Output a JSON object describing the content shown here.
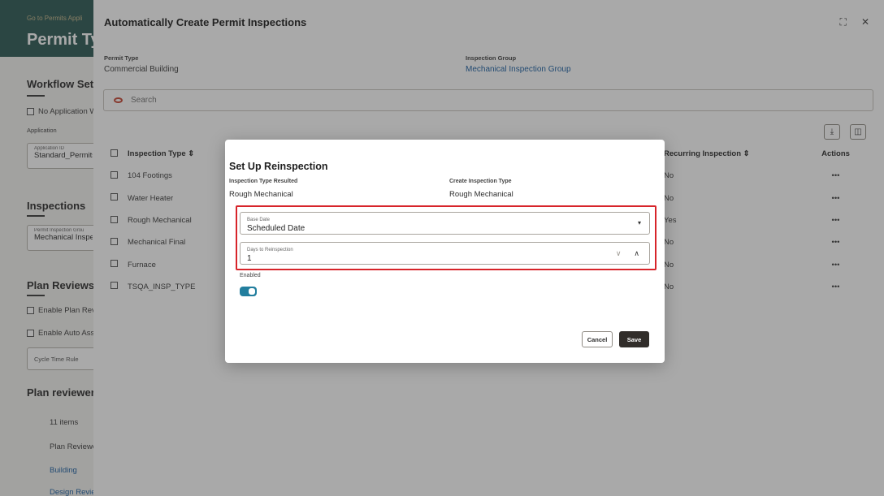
{
  "background": {
    "back_link": "Go to Permits Appli",
    "page_title": "Permit Typ",
    "workflow_heading": "Workflow Setu",
    "no_app_checkbox": "No Application W",
    "application_label": "Application",
    "app_id_label": "Application ID",
    "app_id_value": "Standard_Permits",
    "inspections_heading": "Inspections",
    "insp_group_label": "Permit Inspection Grou",
    "insp_group_value": "Mechanical Inspe",
    "plan_reviews_heading": "Plan Reviews",
    "enable_plan_review": "Enable Plan Revi",
    "enable_auto_assign": "Enable Auto Assi",
    "cycle_time_rule": "Cycle Time Rule",
    "plan_reviewer_heading": "Plan reviewer",
    "items_count": "11 items",
    "list": [
      "Plan Reviewe",
      "Building",
      "Design Revie"
    ]
  },
  "panel": {
    "title": "Automatically Create Permit Inspections",
    "icons": {
      "expand": "expand-icon",
      "close": "close-icon"
    },
    "permit_type_label": "Permit Type",
    "permit_type_value": "Commercial Building",
    "inspection_group_label": "Inspection Group",
    "inspection_group_value": "Mechanical Inspection Group",
    "search_placeholder": "Search",
    "columns": {
      "inspection_type": "Inspection Type",
      "recurring": "Recurring Inspection",
      "actions": "Actions"
    },
    "rows": [
      {
        "type": "104 Footings",
        "recurring": "No",
        "actions": "•••"
      },
      {
        "type": "Water Heater",
        "recurring": "No",
        "actions": "•••"
      },
      {
        "type": "Rough Mechanical",
        "recurring": "Yes",
        "actions": "•••"
      },
      {
        "type": "Mechanical Final",
        "recurring": "No",
        "actions": "•••"
      },
      {
        "type": "Furnace",
        "recurring": "No",
        "actions": "•••"
      },
      {
        "type": "TSQA_INSP_TYPE",
        "recurring": "No",
        "actions": "•••"
      }
    ]
  },
  "dialog": {
    "title": "Set Up Reinspection",
    "type_resulted_label": "Inspection Type Resulted",
    "type_resulted_value": "Rough Mechanical",
    "create_type_label": "Create Inspection Type",
    "create_type_value": "Rough Mechanical",
    "base_date_label": "Base Date",
    "base_date_value": "Scheduled Date",
    "days_label": "Days to Reinspection",
    "days_value": "1",
    "enabled_label": "Enabled",
    "enabled": true,
    "cancel_label": "Cancel",
    "save_label": "Save"
  },
  "colors": {
    "accent_toggle": "#227e9e",
    "highlight": "#d7242a",
    "link": "#1e62a3",
    "primary_button": "#312d2a"
  }
}
